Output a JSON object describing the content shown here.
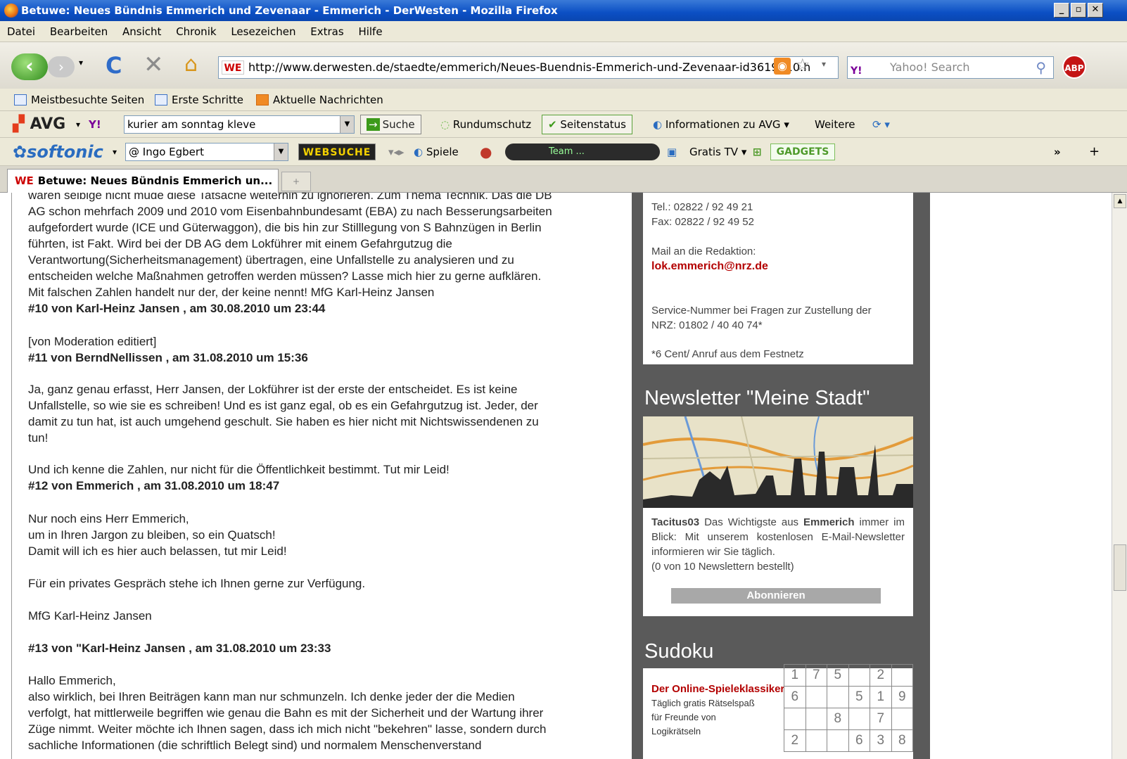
{
  "window": {
    "title": "Betuwe: Neues Bündnis Emmerich und Zevenaar - Emmerich - DerWesten - Mozilla Firefox"
  },
  "menu": [
    "Datei",
    "Bearbeiten",
    "Ansicht",
    "Chronik",
    "Lesezeichen",
    "Extras",
    "Hilfe"
  ],
  "nav": {
    "url": "http://www.derwesten.de/staedte/emmerich/Neues-Buendnis-Emmerich-und-Zevenaar-id3619010.h",
    "favicon": "WE",
    "search_placeholder": "Yahoo! Search",
    "search_brand": "Y!",
    "abp": "ABP"
  },
  "bookmarks": [
    "Meistbesuchte Seiten",
    "Erste Schritte",
    "Aktuelle Nachrichten"
  ],
  "avg_toolbar": {
    "brand": "AVG",
    "search_value": "kurier am sonntag kleve",
    "search_button": "Suche",
    "items": [
      "Rundumschutz",
      "Seitenstatus",
      "Informationen zu AVG",
      "Weitere"
    ]
  },
  "softonic_toolbar": {
    "brand": "softonic",
    "user": "@ Ingo Egbert",
    "websuche": "WEBSUCHE",
    "spiele": "Spiele",
    "radio": "Team ...",
    "tv": "Gratis TV",
    "gadgets": "GADGETS",
    "more": "»"
  },
  "tab": {
    "title": "Betuwe: Neues Bündnis Emmerich un...",
    "favicon": "WE"
  },
  "article": {
    "lines_top": [
      "waren selbige nicht müde diese Tatsache weiterhin zu ignorieren. Zum Thema Technik. Das die DB",
      "AG schon mehrfach 2009 und 2010 vom Eisenbahnbundesamt (EBA) zu nach Besserungsarbeiten",
      "aufgefordert wurde (ICE und Güterwaggon), die bis hin zur Stilllegung von S Bahnzügen in Berlin",
      "führten, ist Fakt. Wird bei der DB AG dem Lokführer mit einem Gefahrgutzug die",
      "Verantwortung(Sicherheitsmanagement) übertragen, eine Unfallstelle zu analysieren und zu",
      "entscheiden welche Maßnahmen getroffen werden müssen? Lasse mich hier zu gerne aufklären.",
      "Mit falschen Zahlen handelt nur der, der keine nennt! MfG Karl-Heinz Jansen"
    ],
    "c10": "#10 von Karl-Heinz Jansen , am 30.08.2010 um 23:44",
    "c10_text": "[von Moderation editiert]",
    "c11": "#11 von BerndNellissen , am 31.08.2010 um 15:36",
    "c11_text": [
      "Ja, ganz genau erfasst, Herr Jansen, der Lokführer ist der erste der entscheidet. Es ist keine",
      "Unfallstelle, so wie sie es schreiben! Und es ist ganz egal, ob es ein Gefahrgutzug ist. Jeder, der",
      "damit zu tun hat, ist auch umgehend geschult. Sie haben es hier nicht mit Nichtswissendenen zu",
      "tun!"
    ],
    "c11_text2": "Und ich kenne die Zahlen, nur nicht für die Öffentlichkeit bestimmt. Tut mir Leid!",
    "c12": "#12 von Emmerich , am 31.08.2010 um 18:47",
    "c12_text": [
      "Nur noch eins Herr Emmerich,",
      "um in Ihren Jargon zu bleiben, so ein Quatsch!",
      "Damit will ich es hier auch belassen, tut mir Leid!"
    ],
    "c12_text2": "Für ein privates Gespräch stehe ich Ihnen gerne zur Verfügung.",
    "c12_sign": "MfG Karl-Heinz Jansen",
    "c13": "#13 von \"Karl-Heinz Jansen , am 31.08.2010 um 23:33",
    "c13_text": [
      "Hallo Emmerich,",
      "also wirklich, bei Ihren Beiträgen kann man nur schmunzeln. Ich denke jeder der die Medien",
      "verfolgt, hat mittlerweile begriffen wie genau die Bahn es mit der Sicherheit und der Wartung ihrer",
      "Züge nimmt. Weiter möchte ich Ihnen sagen, dass ich mich nicht \"bekehren\" lasse, sondern durch",
      "sachliche Informationen (die schriftlich Belegt sind) und normalem Menschenverstand"
    ]
  },
  "sidebar": {
    "tel": "Tel.: 02822 / 92 49 21",
    "fax": "Fax: 02822 / 92 49 52",
    "mail_label": "Mail an die Redaktion:",
    "mail": "lok.emmerich@nrz.de",
    "service1": "Service-Nummer bei Fragen zur Zustellung der",
    "service2": "NRZ: 01802 / 40 40 74*",
    "cent": "*6 Cent/ Anruf aus dem Festnetz",
    "newsletter_title": "Newsletter \"Meine Stadt\"",
    "nl_user": "Tacitus03",
    "nl_text1": " Das Wichtigste aus ",
    "nl_city": "Emmerich",
    "nl_text2": " immer im Blick: Mit unserem kostenlosen E-Mail-Newsletter informieren wir Sie täglich.",
    "nl_count": "(0 von 10 Newslettern bestellt)",
    "abo_button": "Abonnieren",
    "sudoku_title": "Sudoku",
    "sudoku_head": "Der Online-Spieleklassiker",
    "sudoku_sub1": "Täglich gratis Rätselspaß",
    "sudoku_sub2": "für Freunde von",
    "sudoku_sub3": "Logikrätseln",
    "grid": [
      [
        "1",
        "7",
        "5",
        "",
        "2",
        ""
      ],
      [
        "6",
        "",
        "",
        "5",
        "1",
        "9"
      ],
      [
        "",
        "",
        "8",
        "",
        "7",
        ""
      ],
      [
        "2",
        "",
        "",
        "6",
        "3",
        "8"
      ]
    ]
  }
}
